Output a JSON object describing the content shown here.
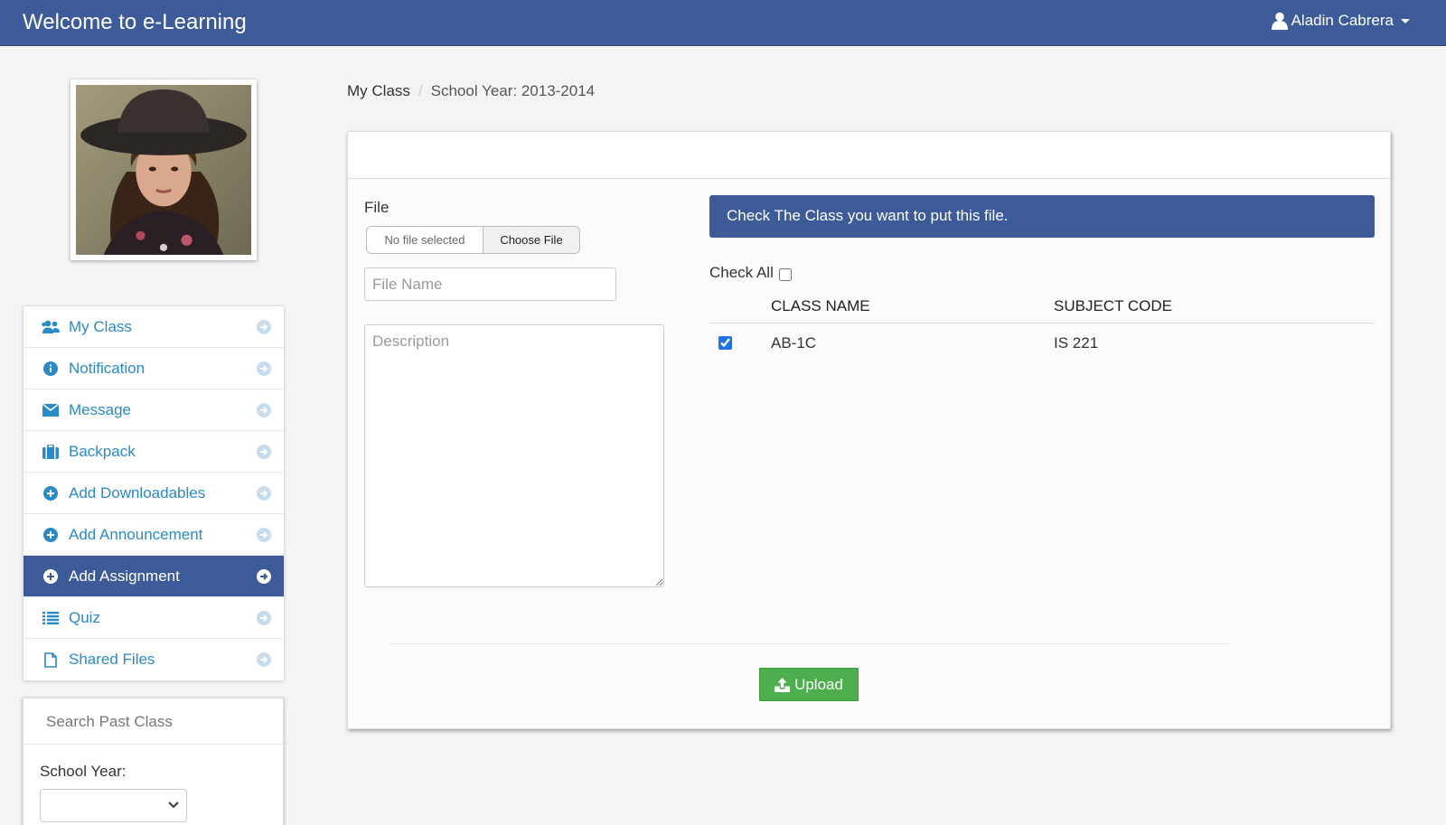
{
  "header": {
    "brand": "Welcome to e-Learning",
    "user_name": "Aladin Cabrera"
  },
  "sidebar": {
    "items": [
      {
        "label": "My Class",
        "icon": "users-icon"
      },
      {
        "label": "Notification",
        "icon": "info-circle-icon"
      },
      {
        "label": "Message",
        "icon": "envelope-icon"
      },
      {
        "label": "Backpack",
        "icon": "briefcase-icon"
      },
      {
        "label": "Add Downloadables",
        "icon": "plus-circle-icon"
      },
      {
        "label": "Add Announcement",
        "icon": "plus-circle-icon"
      },
      {
        "label": "Add Assignment",
        "icon": "plus-circle-icon",
        "active": true
      },
      {
        "label": "Quiz",
        "icon": "list-icon"
      },
      {
        "label": "Shared Files",
        "icon": "file-icon"
      }
    ],
    "search": {
      "title": "Search Past Class",
      "school_year_label": "School Year:",
      "school_year_value": ""
    }
  },
  "breadcrumb": {
    "link": "My Class",
    "current": "School Year: 2013-2014"
  },
  "form": {
    "file_label": "File",
    "file_status": "No file selected",
    "choose_file": "Choose File",
    "file_name_placeholder": "File Name",
    "description_placeholder": "Description",
    "info_text": "Check The Class you want to put this file.",
    "check_all_label": "Check All",
    "columns": [
      "CLASS NAME",
      "SUBJECT CODE"
    ],
    "rows": [
      {
        "class_name": "AB-1C",
        "subject_code": "IS 221",
        "checked": true
      }
    ],
    "upload_label": "Upload"
  },
  "colors": {
    "primary": "#3d5b99",
    "link": "#2a8ac5",
    "success": "#4cae4c"
  }
}
